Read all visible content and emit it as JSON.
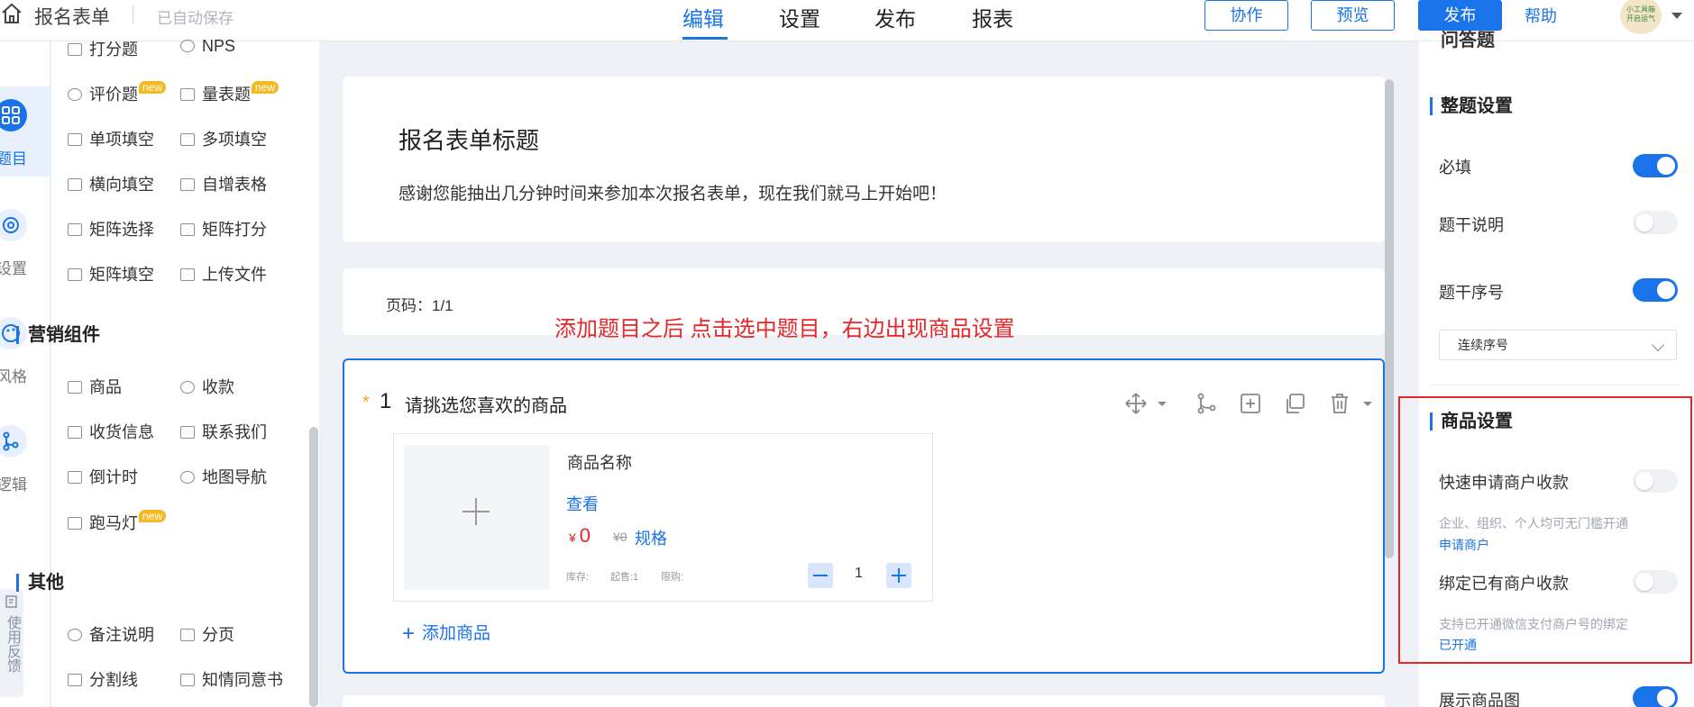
{
  "header": {
    "app_title": "报名表单",
    "autosave": "已自动保存",
    "tabs": [
      "编辑",
      "设置",
      "发布",
      "报表"
    ],
    "btn_collab": "协作",
    "btn_preview": "预览",
    "btn_publish": "发布",
    "help": "帮助",
    "avatar_text_1": "小工具箱",
    "avatar_text_2": "开启运气"
  },
  "rail": {
    "items": [
      "题目",
      "设置",
      "风格",
      "逻辑"
    ],
    "feedback": "使用反馈"
  },
  "palette": {
    "top_items": [
      {
        "label": "打分题"
      },
      {
        "label": "NPS"
      },
      {
        "label": "评价题",
        "badge": "new"
      },
      {
        "label": "量表题",
        "badge": "new"
      },
      {
        "label": "单项填空"
      },
      {
        "label": "多项填空"
      },
      {
        "label": "横向填空"
      },
      {
        "label": "自增表格"
      },
      {
        "label": "矩阵选择"
      },
      {
        "label": "矩阵打分"
      },
      {
        "label": "矩阵填空"
      },
      {
        "label": "上传文件"
      }
    ],
    "marketing_title": "营销组件",
    "marketing_items": [
      {
        "label": "商品"
      },
      {
        "label": "收款"
      },
      {
        "label": "收货信息"
      },
      {
        "label": "联系我们"
      },
      {
        "label": "倒计时"
      },
      {
        "label": "地图导航"
      },
      {
        "label": "跑马灯",
        "badge": "new"
      }
    ],
    "other_title": "其他",
    "other_items": [
      {
        "label": "备注说明"
      },
      {
        "label": "分页"
      },
      {
        "label": "分割线"
      },
      {
        "label": "知情同意书"
      }
    ]
  },
  "canvas": {
    "form_title": "报名表单标题",
    "form_desc": "感谢您能抽出几分钟时间来参加本次报名表单，现在我们就马上开始吧！",
    "page_num": "页码：1/1",
    "annotation": "添加题目之后 点击选中题目，右边出现商品设置",
    "question": {
      "star": "*",
      "number": "1",
      "text": "请挑选您喜欢的商品",
      "product": {
        "name": "商品名称",
        "view": "查看",
        "currency": "¥",
        "price": "0",
        "old_price": "¥0",
        "spec": "规格",
        "stock_label": "库存:",
        "min_label": "起售:1",
        "limit_label": "限购:",
        "quantity": "1"
      },
      "add_product": "添加商品"
    }
  },
  "settings": {
    "clipped_header": "问答题",
    "whole_title": "整题设置",
    "required_label": "必填",
    "required_on": true,
    "desc_label": "题干说明",
    "desc_on": false,
    "seq_label": "题干序号",
    "seq_on": true,
    "seq_select": "连续序号",
    "product_title": "商品设置",
    "quick_pay_label": "快速申请商户收款",
    "quick_pay_on": false,
    "quick_pay_hint": "企业、组织、个人均可无门槛开通",
    "quick_pay_link": "申请商户",
    "bind_pay_label": "绑定已有商户收款",
    "bind_pay_on": false,
    "bind_pay_hint": "支持已开通微信支付商户号的绑定",
    "bind_pay_link": "已开通",
    "show_image_label": "展示商品图",
    "show_image_on": true
  },
  "colors": {
    "accent": "#1a73e8",
    "annotation": "#e8262a",
    "background": "#eef1f6"
  }
}
